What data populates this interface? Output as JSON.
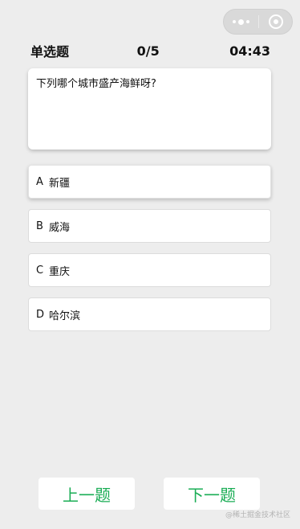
{
  "capsule": {
    "more_icon": "more-dots-icon",
    "close_icon": "close-circle-icon"
  },
  "header": {
    "type_label": "单选题",
    "progress": "0/5",
    "timer": "04:43"
  },
  "question": {
    "text": "下列哪个城市盛产海鲜呀?"
  },
  "options": [
    {
      "letter": "A",
      "text": "新疆"
    },
    {
      "letter": "B",
      "text": "威海"
    },
    {
      "letter": "C",
      "text": "重庆"
    },
    {
      "letter": "D",
      "text": "哈尔滨"
    }
  ],
  "buttons": {
    "prev_label": "上一题",
    "next_label": "下一题"
  },
  "watermark": "@稀土掘金技术社区",
  "colors": {
    "accent": "#1aad55",
    "background": "#ededed"
  }
}
